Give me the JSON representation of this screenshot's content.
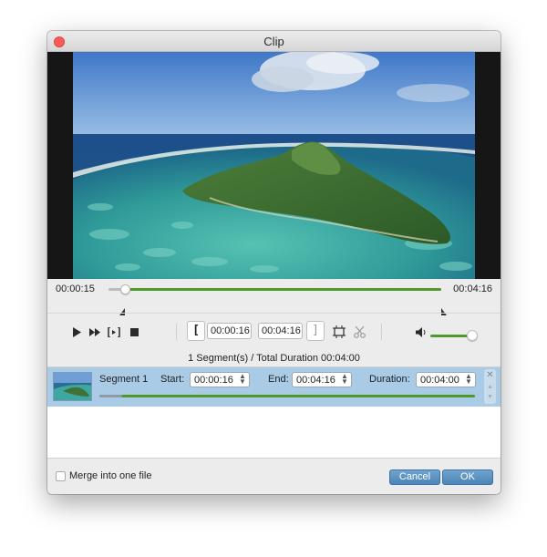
{
  "window": {
    "title": "Clip"
  },
  "timeline": {
    "current_time": "00:00:15",
    "total_time": "00:04:16",
    "playhead_fraction": 0.05,
    "selection_start_fraction": 0.05,
    "selection_end_fraction": 1.0
  },
  "controls": {
    "set_start_glyph": "[",
    "set_end_glyph": "]",
    "start_time": "00:00:16",
    "end_time": "00:04:16",
    "volume_fraction": 0.95
  },
  "summary": {
    "text": "1 Segment(s) / Total Duration 00:04:00"
  },
  "segments": [
    {
      "name": "Segment 1",
      "start_label": "Start:",
      "start_value": "00:00:16",
      "end_label": "End:",
      "end_value": "00:04:16",
      "duration_label": "Duration:",
      "duration_value": "00:04:00"
    }
  ],
  "footer": {
    "merge_label": "Merge into one file",
    "cancel_label": "Cancel",
    "ok_label": "OK"
  },
  "colors": {
    "accent_green": "#4f9a2a",
    "selection_blue": "#aacbe6",
    "button_blue": "#5a92c4",
    "close_red": "#fc5b57"
  },
  "icons": {
    "play": "play-icon",
    "fast_forward": "fast-forward-icon",
    "clip_bracket": "clip-bracket-icon",
    "stop": "stop-icon",
    "crop": "crop-icon",
    "cut": "scissors-icon",
    "volume": "volume-icon"
  }
}
